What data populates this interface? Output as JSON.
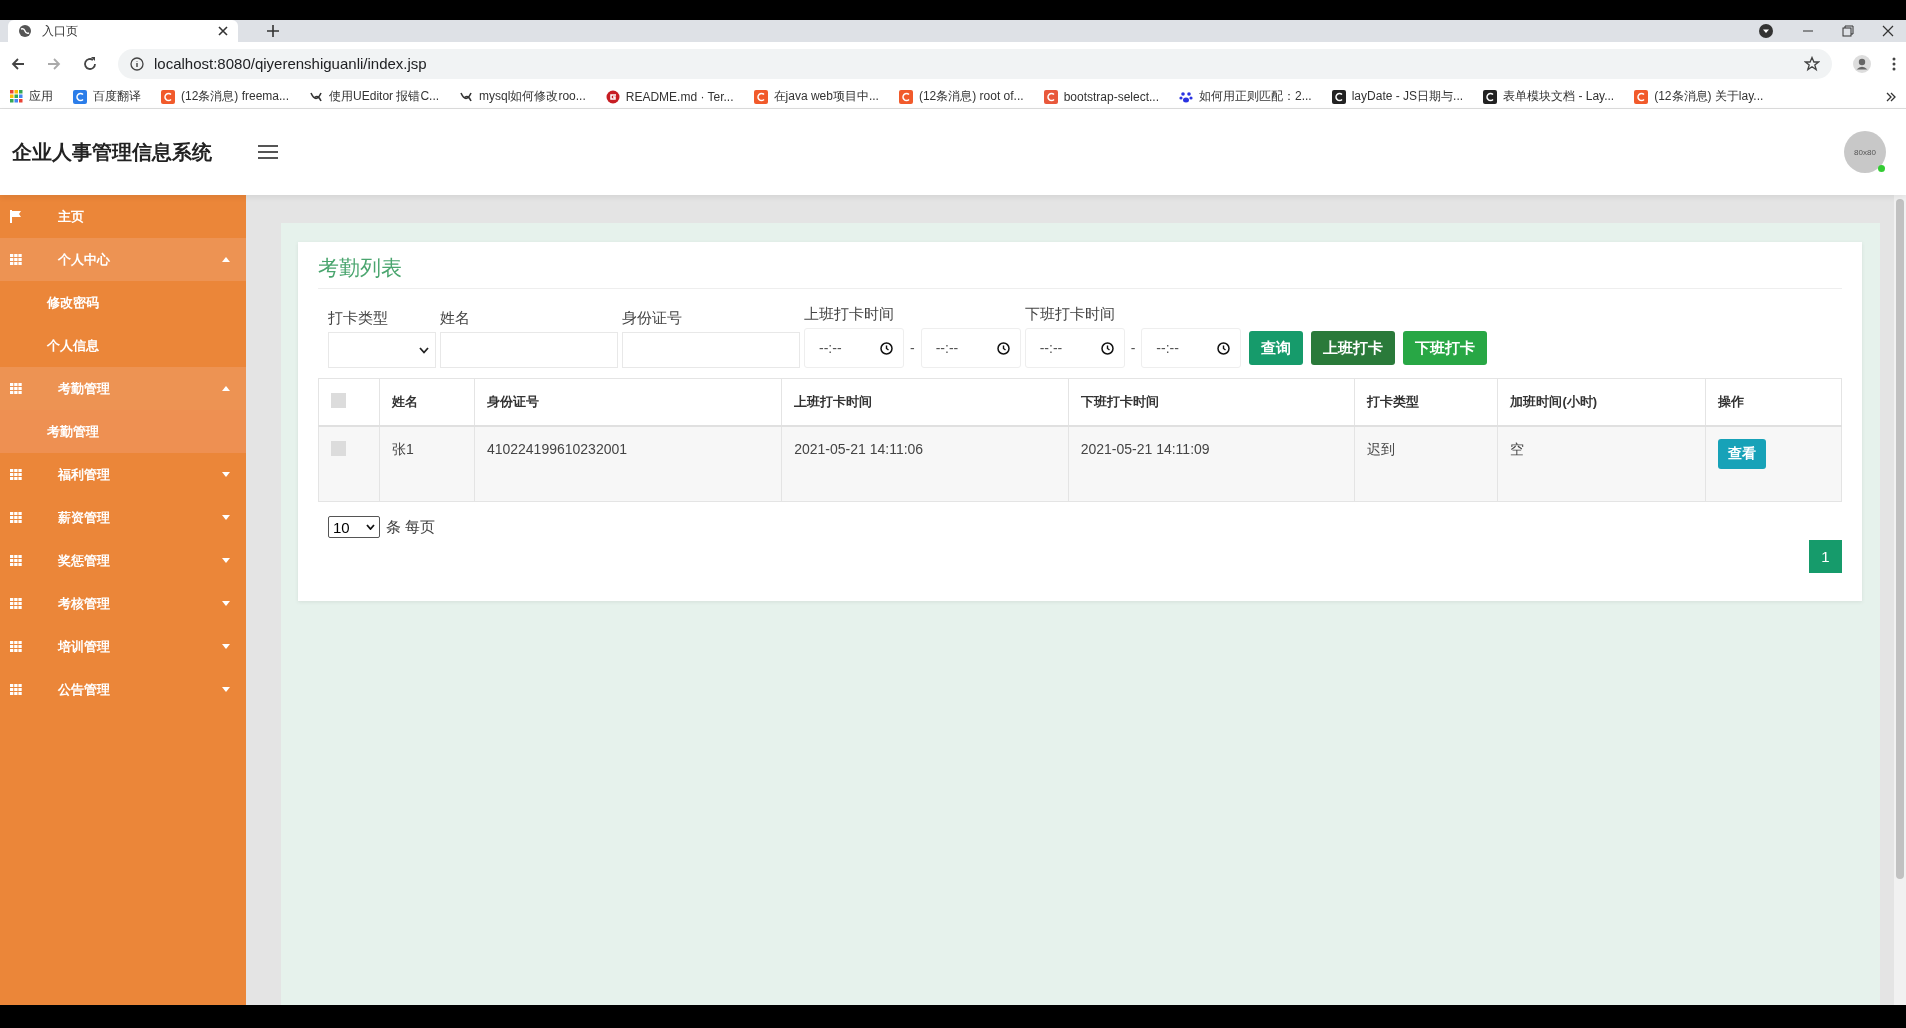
{
  "browser": {
    "tab_title": "入口页",
    "url": "localhost:8080/qiyerenshiguanli/index.jsp",
    "bookmarks": [
      {
        "label": "应用",
        "kind": "apps"
      },
      {
        "label": "百度翻译",
        "kind": "translate"
      },
      {
        "label": "(12条消息) freema...",
        "kind": "csdn"
      },
      {
        "label": "使用UEditor 报错C...",
        "kind": "swirl"
      },
      {
        "label": "mysql如何修改roo...",
        "kind": "swirl"
      },
      {
        "label": "README.md · Ter...",
        "kind": "gitee"
      },
      {
        "label": "在java web项目中...",
        "kind": "csdn"
      },
      {
        "label": "(12条消息) root of...",
        "kind": "csdn"
      },
      {
        "label": "bootstrap-select...",
        "kind": "jian"
      },
      {
        "label": "如何用正则匹配：2...",
        "kind": "paw"
      },
      {
        "label": "layDate - JS日期与...",
        "kind": "layui"
      },
      {
        "label": "表单模块文档 - Lay...",
        "kind": "layui"
      },
      {
        "label": "(12条消息) 关于lay...",
        "kind": "csdn"
      }
    ]
  },
  "header": {
    "title": "企业人事管理信息系统",
    "avatar_text": "80x80"
  },
  "sidebar": {
    "items": [
      {
        "label": "主页",
        "kind": "link"
      },
      {
        "label": "个人中心",
        "kind": "group",
        "expanded": true,
        "children": [
          {
            "label": "修改密码",
            "selected": false
          },
          {
            "label": "个人信息",
            "selected": false
          }
        ]
      },
      {
        "label": "考勤管理",
        "kind": "group",
        "expanded": true,
        "children": [
          {
            "label": "考勤管理",
            "selected": true
          }
        ]
      },
      {
        "label": "福利管理",
        "kind": "group",
        "expanded": false
      },
      {
        "label": "薪资管理",
        "kind": "group",
        "expanded": false
      },
      {
        "label": "奖惩管理",
        "kind": "group",
        "expanded": false
      },
      {
        "label": "考核管理",
        "kind": "group",
        "expanded": false
      },
      {
        "label": "培训管理",
        "kind": "group",
        "expanded": false
      },
      {
        "label": "公告管理",
        "kind": "group",
        "expanded": false
      }
    ]
  },
  "card": {
    "title": "考勤列表",
    "filters": {
      "type_label": "打卡类型",
      "name_label": "姓名",
      "id_label": "身份证号",
      "in_label": "上班打卡时间",
      "out_label": "下班打卡时间",
      "time_placeholder": "--:--",
      "range_sep": "-"
    },
    "buttons": [
      {
        "label": "查询",
        "kind": "search"
      },
      {
        "label": "上班打卡",
        "kind": "clockin"
      },
      {
        "label": "下班打卡",
        "kind": "clockout"
      }
    ],
    "table": {
      "select_all_checked": false,
      "columns": [
        "姓名",
        "身份证号",
        "上班打卡时间",
        "下班打卡时间",
        "打卡类型",
        "加班时间(小时)",
        "操作"
      ],
      "rows": [
        {
          "checked": false,
          "cells": [
            "张1",
            "410224199610232001",
            "2021-05-21 14:11:06",
            "2021-05-21 14:11:09",
            "迟到",
            "空"
          ],
          "action": "查看"
        }
      ]
    },
    "page_size": "10",
    "page_size_suffix": "条 每页",
    "pages": [
      {
        "label": "1",
        "selected": true
      }
    ]
  }
}
